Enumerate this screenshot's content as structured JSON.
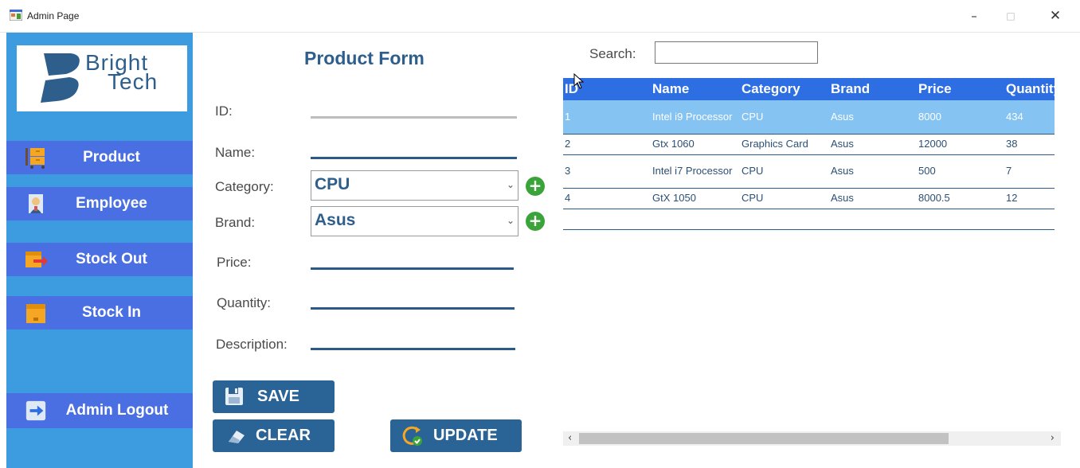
{
  "window": {
    "title": "Admin Page",
    "minimize": "–",
    "maximize": "□",
    "close": "✕"
  },
  "logo": {
    "line1": "Bright",
    "line2": "Tech",
    "color": "#2e5f8c"
  },
  "sidebar": {
    "bg": "#3d9be0",
    "item_bg": "#4a6fe3",
    "items": [
      {
        "label": "Product",
        "icon": "product-cart-icon"
      },
      {
        "label": "Employee",
        "icon": "employee-icon"
      },
      {
        "label": "Stock Out",
        "icon": "stock-out-icon"
      },
      {
        "label": "Stock In",
        "icon": "stock-in-icon"
      }
    ],
    "logout": {
      "label": "Admin Logout",
      "icon": "logout-icon"
    }
  },
  "form": {
    "title": "Product Form",
    "id_label": "ID:",
    "name_label": "Name:",
    "category_label": "Category:",
    "category_value": "CPU",
    "brand_label": "Brand:",
    "brand_value": "Asus",
    "price_label": "Price:",
    "quantity_label": "Quantity:",
    "description_label": "Description:"
  },
  "buttons": {
    "save": "SAVE",
    "clear": "CLEAR",
    "update": "UPDATE"
  },
  "search": {
    "label": "Search:",
    "value": ""
  },
  "grid": {
    "header_bg": "#2e6ee3",
    "columns": [
      "ID",
      "Name",
      "Category",
      "Brand",
      "Price",
      "Quantity"
    ],
    "rows": [
      {
        "id": "1",
        "name": "Intel i9 Processor",
        "category": "CPU",
        "brand": "Asus",
        "price": "8000",
        "quantity": "434",
        "selected": true
      },
      {
        "id": "2",
        "name": "Gtx 1060",
        "category": "Graphics Card",
        "brand": "Asus",
        "price": "12000",
        "quantity": "38",
        "selected": false
      },
      {
        "id": "3",
        "name": "Intel i7 Processor",
        "category": "CPU",
        "brand": "Asus",
        "price": "500",
        "quantity": "7",
        "selected": false
      },
      {
        "id": "4",
        "name": "GtX 1050",
        "category": "CPU",
        "brand": "Asus",
        "price": "8000.5",
        "quantity": "12",
        "selected": false
      }
    ]
  }
}
